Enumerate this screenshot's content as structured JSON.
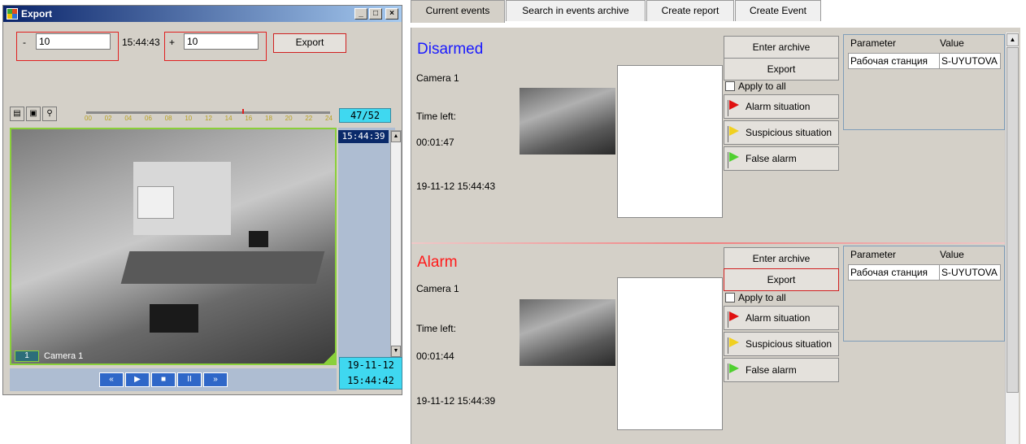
{
  "export_window": {
    "title": "Export",
    "title_buttons": [
      "_",
      "□",
      "×"
    ],
    "minus_label": "-",
    "minus_value": "10",
    "time": "15:44:43",
    "plus_label": "+",
    "plus_value": "10",
    "export_button": "Export",
    "toolbar_icons": [
      "print-icon",
      "save-icon",
      "zoom-icon"
    ],
    "timeline_ticks": [
      "00",
      "02",
      "04",
      "06",
      "08",
      "10",
      "12",
      "14",
      "16",
      "18",
      "20",
      "22",
      "24"
    ],
    "counter": "47/52",
    "video_time": "15:44:39",
    "camera_number": "1",
    "camera_name": "Camera 1",
    "date": "19-11-12",
    "time_bottom": "15:44:42",
    "playback_controls": [
      "«",
      "▶",
      "■",
      "II",
      "»"
    ]
  },
  "tabs": [
    "Current events",
    "Search in events archive",
    "Create report",
    "Create Event"
  ],
  "events": [
    {
      "status": "Disarmed",
      "status_color": "#1a1aff",
      "camera": "Camera 1",
      "time_left_label": "Time left:",
      "time_left": "00:01:47",
      "timestamp": "19-11-12 15:44:43",
      "enter_archive": "Enter archive",
      "export": "Export",
      "apply_to_all": "Apply to all",
      "alarm_situation": "Alarm situation",
      "suspicious_situation": "Suspicious situation",
      "false_alarm": "False alarm",
      "param_header": "Parameter",
      "value_header": "Value",
      "param_name": "Рабочая станция",
      "param_value": "S-UYUTOVA"
    },
    {
      "status": "Alarm",
      "status_color": "#ff1a1a",
      "camera": "Camera 1",
      "time_left_label": "Time left:",
      "time_left": "00:01:44",
      "timestamp": "19-11-12 15:44:39",
      "enter_archive": "Enter archive",
      "export": "Export",
      "apply_to_all": "Apply to all",
      "alarm_situation": "Alarm situation",
      "suspicious_situation": "Suspicious situation",
      "false_alarm": "False alarm",
      "param_header": "Parameter",
      "value_header": "Value",
      "param_name": "Рабочая станция",
      "param_value": "S-UYUTOVA"
    }
  ],
  "flag_colors": {
    "alarm": "#e01010",
    "suspicious": "#f0d020",
    "false": "#50d030"
  }
}
